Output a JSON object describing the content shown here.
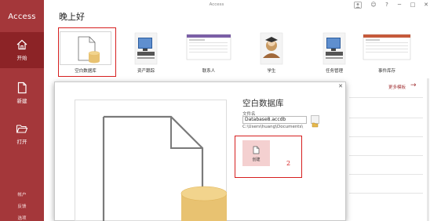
{
  "window": {
    "title": "Access"
  },
  "titlebar": {
    "buttons": [
      {
        "name": "feedback-face",
        "glyph": "☺"
      },
      {
        "name": "help",
        "glyph": "?"
      },
      {
        "name": "minimize",
        "glyph": "─"
      },
      {
        "name": "maximize",
        "glyph": "□"
      },
      {
        "name": "close",
        "glyph": "✕"
      }
    ]
  },
  "nav": {
    "app_name": "Access",
    "items": [
      {
        "label": "开始",
        "icon": "home-icon",
        "active": true
      },
      {
        "label": "新建",
        "icon": "new-file-icon",
        "active": false
      },
      {
        "label": "打开",
        "icon": "open-folder-icon",
        "active": false
      }
    ],
    "bottom": [
      {
        "label": "帐户"
      },
      {
        "label": "反馈"
      },
      {
        "label": "选项"
      }
    ]
  },
  "main": {
    "greeting": "晚上好",
    "templates": [
      {
        "label": "空白数据库",
        "icon": "blank-database-icon",
        "highlight_number": "1"
      },
      {
        "label": "资产跟踪",
        "icon": "asset-tracking-icon"
      },
      {
        "label": "联系人",
        "icon": "contacts-icon"
      },
      {
        "label": "学生",
        "icon": "students-icon"
      },
      {
        "label": "任务管理",
        "icon": "task-management-icon"
      },
      {
        "label": "事件库存",
        "icon": "inventory-icon"
      }
    ],
    "more_templates": "更多模板",
    "more_arrow": "→"
  },
  "dialog": {
    "title": "空白数据库",
    "close_glyph": "✕",
    "file_name_label": "文件名",
    "file_name_value": "Database8.accdb",
    "path": "C:\\Users\\huang\\Documents\\",
    "create_label": "创建",
    "highlight_number": "2"
  },
  "colors": {
    "accent": "#a4373a",
    "accent_active": "#8c2326",
    "highlight_box": "#d61f1f",
    "create_button_bg": "#f4d0d0",
    "database_gold": "#e8c271"
  }
}
